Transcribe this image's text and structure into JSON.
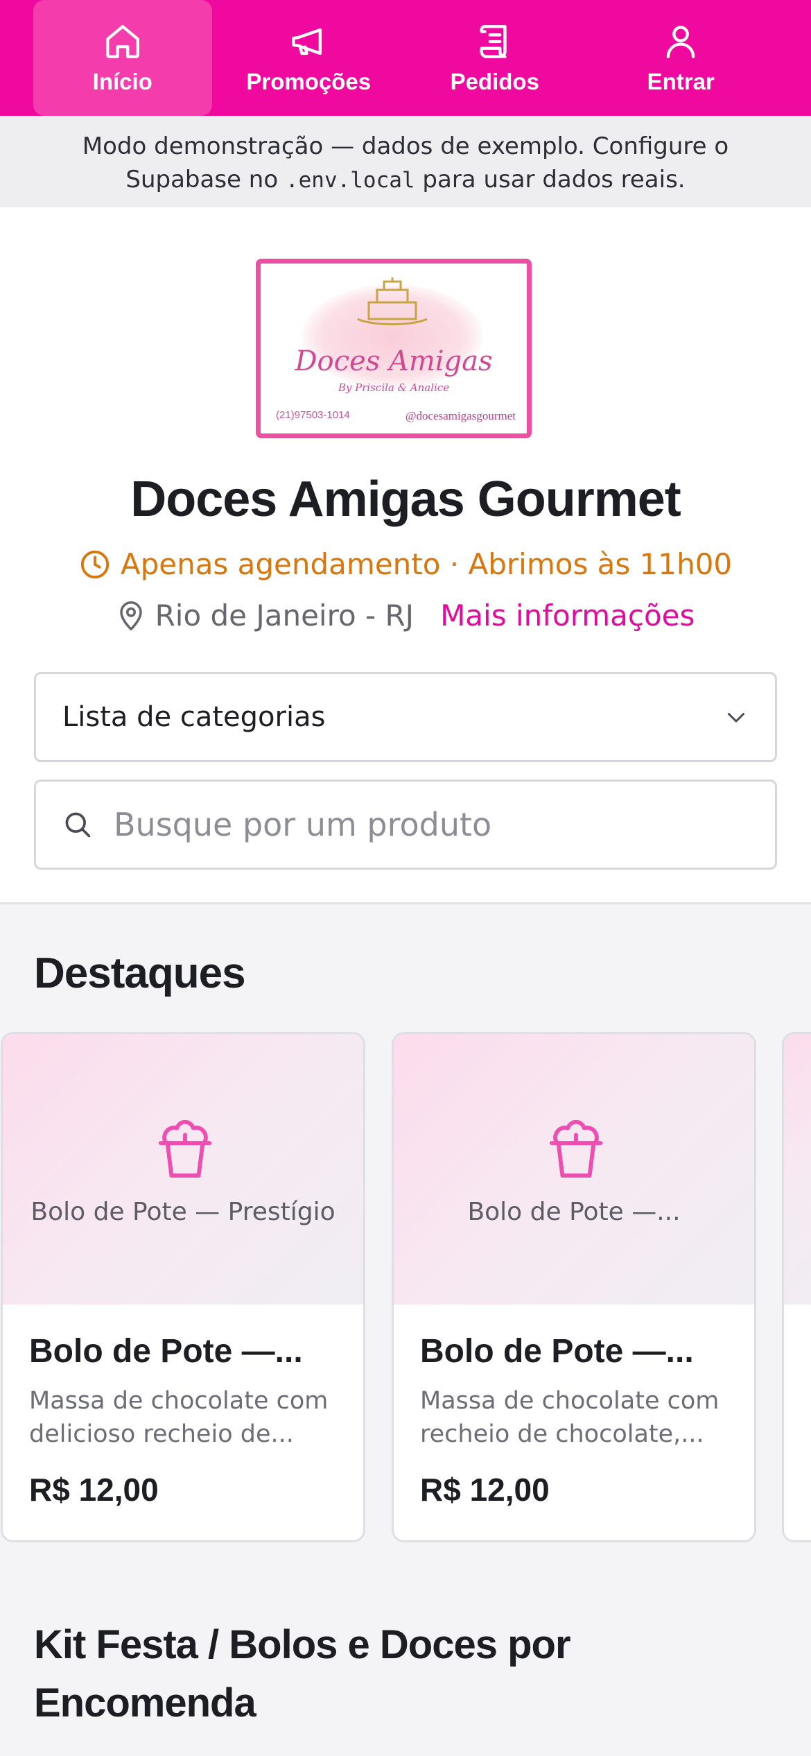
{
  "nav": {
    "items": [
      {
        "label": "Início",
        "icon": "home-icon",
        "active": true
      },
      {
        "label": "Promoções",
        "icon": "megaphone-icon",
        "active": false
      },
      {
        "label": "Pedidos",
        "icon": "receipt-icon",
        "active": false
      },
      {
        "label": "Entrar",
        "icon": "user-icon",
        "active": false
      }
    ]
  },
  "banner": {
    "text_before": "Modo demonstração — dados de exemplo. Configure o Supabase no",
    "code": ".env.local",
    "text_after": "para usar dados reais."
  },
  "store": {
    "logo": {
      "brand": "Doces Amigas",
      "byline": "By Priscila & Analice",
      "phone": "(21)97503-1014",
      "instagram": "@docesamigasgourmet"
    },
    "name": "Doces Amigas Gourmet",
    "hours": "Apenas agendamento · Abrimos às 11h00",
    "city": "Rio de Janeiro - RJ",
    "more_info": "Mais informações"
  },
  "filters": {
    "category_select": "Lista de categorias",
    "search_placeholder": "Busque por um produto"
  },
  "highlights": {
    "title": "Destaques",
    "products": [
      {
        "thumb_label": "Bolo de Pote — Prestígio",
        "name": "Bolo de Pote —...",
        "description": "Massa de chocolate com delicioso recheio de...",
        "price": "R$ 12,00"
      },
      {
        "thumb_label": "Bolo de Pote —...",
        "name": "Bolo de Pote —...",
        "description": "Massa de chocolate com recheio de chocolate,...",
        "price": "R$ 12,00"
      }
    ]
  },
  "next_section": {
    "title": "Kit Festa / Bolos e Doces por Encomenda"
  },
  "colors": {
    "brand_pink": "#f0099f",
    "hours_orange": "#d9770b",
    "link_pink": "#e30aa2"
  }
}
